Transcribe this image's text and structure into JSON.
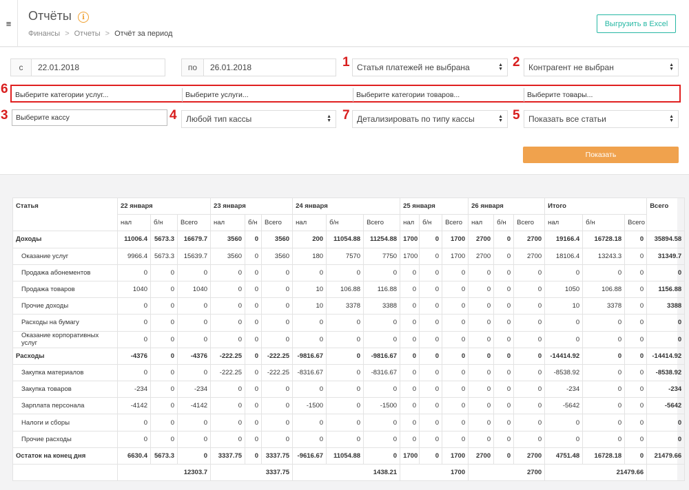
{
  "header": {
    "title": "Отчёты",
    "info_icon_glyph": "i",
    "breadcrumb": [
      "Финансы",
      "Отчеты",
      "Отчёт за период"
    ],
    "excel_button": "Выгрузить в Excel"
  },
  "filters": {
    "date_from_prefix": "с",
    "date_from": "22.01.2018",
    "date_to_prefix": "по",
    "date_to": "26.01.2018",
    "payment_article": "Статья платежей не выбрана",
    "counterparty": "Контрагент не выбран",
    "service_categories": "Выберите категории услуг...",
    "services": "Выберите услуги...",
    "product_categories": "Выберите категории товаров...",
    "products": "Выберите товары...",
    "cashbox": "Выберите кассу",
    "cashbox_type": "Любой тип кассы",
    "detail_by_type": "Детализировать по типу кассы",
    "show_articles": "Показать все статьи",
    "show_button": "Показать"
  },
  "markers": {
    "m1": "1",
    "m2": "2",
    "m3": "3",
    "m4": "4",
    "m5": "5",
    "m6": "6",
    "m7": "7"
  },
  "table": {
    "article_header": "Статья",
    "days": [
      "22 января",
      "23 января",
      "24 января",
      "25 января",
      "26 января"
    ],
    "total_header": "Итого",
    "grand_header": "Всего",
    "sub_headers": [
      "нал",
      "б/н",
      "Всего"
    ],
    "rows": [
      {
        "label": "Доходы",
        "bold": true,
        "cells": [
          "11006.4",
          "5673.3",
          "16679.7",
          "3560",
          "0",
          "3560",
          "200",
          "11054.88",
          "11254.88",
          "1700",
          "0",
          "1700",
          "2700",
          "0",
          "2700",
          "19166.4",
          "16728.18",
          "0",
          "35894.58"
        ]
      },
      {
        "label": "Оказание услуг",
        "bold": false,
        "cells": [
          "9966.4",
          "5673.3",
          "15639.7",
          "3560",
          "0",
          "3560",
          "180",
          "7570",
          "7750",
          "1700",
          "0",
          "1700",
          "2700",
          "0",
          "2700",
          "18106.4",
          "13243.3",
          "0",
          "31349.7"
        ]
      },
      {
        "label": "Продажа абонементов",
        "bold": false,
        "cells": [
          "0",
          "0",
          "0",
          "0",
          "0",
          "0",
          "0",
          "0",
          "0",
          "0",
          "0",
          "0",
          "0",
          "0",
          "0",
          "0",
          "0",
          "0",
          "0"
        ]
      },
      {
        "label": "Продажа товаров",
        "bold": false,
        "cells": [
          "1040",
          "0",
          "1040",
          "0",
          "0",
          "0",
          "10",
          "106.88",
          "116.88",
          "0",
          "0",
          "0",
          "0",
          "0",
          "0",
          "1050",
          "106.88",
          "0",
          "1156.88"
        ]
      },
      {
        "label": "Прочие доходы",
        "bold": false,
        "cells": [
          "0",
          "0",
          "0",
          "0",
          "0",
          "0",
          "10",
          "3378",
          "3388",
          "0",
          "0",
          "0",
          "0",
          "0",
          "0",
          "10",
          "3378",
          "0",
          "3388"
        ]
      },
      {
        "label": "Расходы на бумагу",
        "bold": false,
        "cells": [
          "0",
          "0",
          "0",
          "0",
          "0",
          "0",
          "0",
          "0",
          "0",
          "0",
          "0",
          "0",
          "0",
          "0",
          "0",
          "0",
          "0",
          "0",
          "0"
        ]
      },
      {
        "label": "Оказание корпоративных услуг",
        "bold": false,
        "cells": [
          "0",
          "0",
          "0",
          "0",
          "0",
          "0",
          "0",
          "0",
          "0",
          "0",
          "0",
          "0",
          "0",
          "0",
          "0",
          "0",
          "0",
          "0",
          "0"
        ]
      },
      {
        "label": "Расходы",
        "bold": true,
        "cells": [
          "-4376",
          "0",
          "-4376",
          "-222.25",
          "0",
          "-222.25",
          "-9816.67",
          "0",
          "-9816.67",
          "0",
          "0",
          "0",
          "0",
          "0",
          "0",
          "-14414.92",
          "0",
          "0",
          "-14414.92"
        ]
      },
      {
        "label": "Закупка материалов",
        "bold": false,
        "cells": [
          "0",
          "0",
          "0",
          "-222.25",
          "0",
          "-222.25",
          "-8316.67",
          "0",
          "-8316.67",
          "0",
          "0",
          "0",
          "0",
          "0",
          "0",
          "-8538.92",
          "0",
          "0",
          "-8538.92"
        ]
      },
      {
        "label": "Закупка товаров",
        "bold": false,
        "cells": [
          "-234",
          "0",
          "-234",
          "0",
          "0",
          "0",
          "0",
          "0",
          "0",
          "0",
          "0",
          "0",
          "0",
          "0",
          "0",
          "-234",
          "0",
          "0",
          "-234"
        ]
      },
      {
        "label": "Зарплата персонала",
        "bold": false,
        "cells": [
          "-4142",
          "0",
          "-4142",
          "0",
          "0",
          "0",
          "-1500",
          "0",
          "-1500",
          "0",
          "0",
          "0",
          "0",
          "0",
          "0",
          "-5642",
          "0",
          "0",
          "-5642"
        ]
      },
      {
        "label": "Налоги и сборы",
        "bold": false,
        "cells": [
          "0",
          "0",
          "0",
          "0",
          "0",
          "0",
          "0",
          "0",
          "0",
          "0",
          "0",
          "0",
          "0",
          "0",
          "0",
          "0",
          "0",
          "0",
          "0"
        ]
      },
      {
        "label": "Прочие расходы",
        "bold": false,
        "cells": [
          "0",
          "0",
          "0",
          "0",
          "0",
          "0",
          "0",
          "0",
          "0",
          "0",
          "0",
          "0",
          "0",
          "0",
          "0",
          "0",
          "0",
          "0",
          "0"
        ]
      },
      {
        "label": "Остаток на конец дня",
        "bold": true,
        "cells": [
          "6630.4",
          "5673.3",
          "0",
          "3337.75",
          "0",
          "3337.75",
          "-9616.67",
          "11054.88",
          "0",
          "1700",
          "0",
          "1700",
          "2700",
          "0",
          "2700",
          "4751.48",
          "16728.18",
          "0",
          "21479.66"
        ]
      }
    ],
    "totals": [
      "12303.7",
      "3337.75",
      "1438.21",
      "1700",
      "2700",
      "21479.66"
    ]
  }
}
